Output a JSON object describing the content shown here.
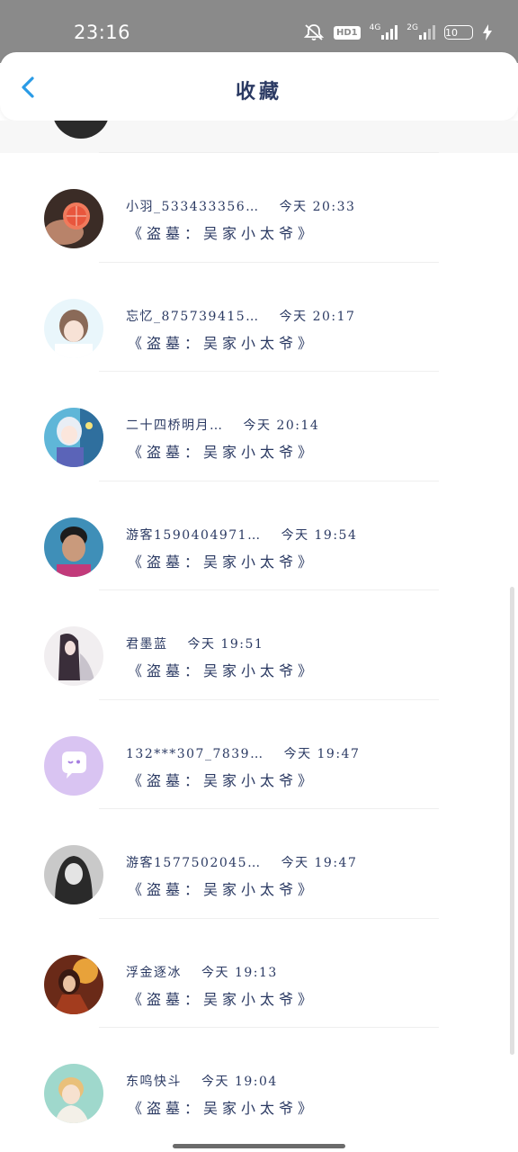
{
  "status_bar": {
    "time": "23:16",
    "hd_label": "HD1",
    "network1": "4G",
    "network2": "2G",
    "battery": "10",
    "icons": [
      "mute-icon",
      "hd-icon",
      "signal-4g-icon",
      "signal-2g-icon",
      "battery-icon",
      "charging-icon"
    ]
  },
  "header": {
    "title": "收藏",
    "back_icon": "chevron-left-icon",
    "accent": "#2a9be6"
  },
  "colors": {
    "text": "#2b3a63",
    "status_bar_bg": "#8a8a8a"
  },
  "favorites": [
    {
      "name": "小羽_533433356…",
      "time": "今天 20:33",
      "book": "《盗墓：吴家小太爷》"
    },
    {
      "name": "忘忆_875739415…",
      "time": "今天 20:17",
      "book": "《盗墓：吴家小太爷》"
    },
    {
      "name": "二十四桥明月…",
      "time": "今天 20:14",
      "book": "《盗墓：吴家小太爷》"
    },
    {
      "name": "游客1590404971…",
      "time": "今天 19:54",
      "book": "《盗墓：吴家小太爷》"
    },
    {
      "name": "君墨蓝",
      "time": "今天 19:51",
      "book": "《盗墓：吴家小太爷》"
    },
    {
      "name": "132***307_7839…",
      "time": "今天 19:47",
      "book": "《盗墓：吴家小太爷》"
    },
    {
      "name": "游客1577502045…",
      "time": "今天 19:47",
      "book": "《盗墓：吴家小太爷》"
    },
    {
      "name": "浮金逐冰",
      "time": "今天 19:13",
      "book": "《盗墓：吴家小太爷》"
    },
    {
      "name": "东鸣快斗",
      "time": "今天 19:04",
      "book": "《盗墓：吴家小太爷》"
    }
  ]
}
